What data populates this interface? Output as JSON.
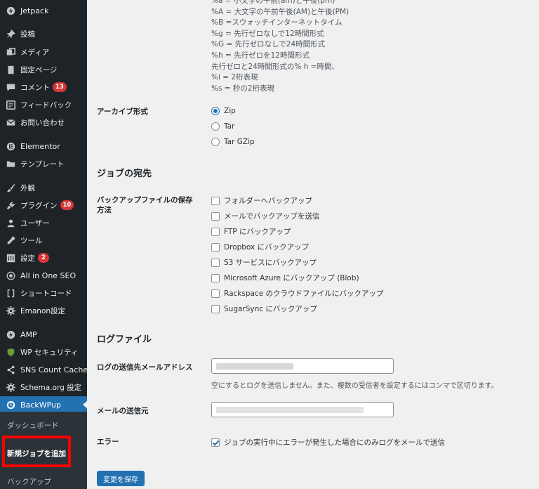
{
  "sidebar": {
    "items": [
      {
        "label": "Jetpack",
        "icon": "jetpack-icon"
      },
      {
        "label": "投稿",
        "icon": "pin-icon"
      },
      {
        "label": "メディア",
        "icon": "media-icon"
      },
      {
        "label": "固定ページ",
        "icon": "page-icon"
      },
      {
        "label": "コメント",
        "icon": "comment-icon",
        "badge": "13"
      },
      {
        "label": "フィードバック",
        "icon": "feedback-icon"
      },
      {
        "label": "お問い合わせ",
        "icon": "mail-icon"
      },
      {
        "label": "Elementor",
        "icon": "elementor-icon"
      },
      {
        "label": "テンプレート",
        "icon": "folder-icon"
      },
      {
        "label": "外観",
        "icon": "brush-icon"
      },
      {
        "label": "プラグイン",
        "icon": "plugin-icon",
        "badge": "10"
      },
      {
        "label": "ユーザー",
        "icon": "user-icon"
      },
      {
        "label": "ツール",
        "icon": "wrench-icon"
      },
      {
        "label": "設定",
        "icon": "settings-icon",
        "badge": "2"
      },
      {
        "label": "All in One SEO",
        "icon": "seo-icon"
      },
      {
        "label": "ショートコード",
        "icon": "shortcode-icon"
      },
      {
        "label": "Emanon設定",
        "icon": "gear-icon"
      },
      {
        "label": "AMP",
        "icon": "amp-icon"
      },
      {
        "label": "WP セキュリティ",
        "icon": "shield-icon"
      },
      {
        "label": "SNS Count Cache",
        "icon": "share-icon"
      },
      {
        "label": "Schema.org 設定",
        "icon": "gear-icon"
      },
      {
        "label": "BackWPup",
        "icon": "backwpup-icon"
      }
    ],
    "submenu": {
      "dashboard": "ダッシュボード",
      "add_job": "新規ジョブを追加",
      "backup": "バックアップ"
    }
  },
  "main": {
    "format_lines": [
      "%a = 小文字の午前(am)と午後(pm)",
      "%A = 大文字の午前午後(AM)と午後(PM)",
      "%B =スウォッチインターネットタイム",
      "%g = 先行ゼロなしで12時間形式",
      "%G = 先行ゼロなしで24時間形式",
      "%h = 先行ゼロを12時間形式",
      "先行ゼロと24時間形式の% h =時間、",
      "%i = 2桁表現",
      "%s = 秒の2桁表現"
    ],
    "archive_format": {
      "label": "アーカイブ形式",
      "options": [
        "Zip",
        "Tar",
        "Tar GZip"
      ],
      "selected": "Zip"
    },
    "job_destination": {
      "title": "ジョブの宛先",
      "label": "バックアップファイルの保存方法",
      "options": [
        "フォルダーへバックアップ",
        "メールでバックアップを送信",
        "FTP にバックアップ",
        "Dropbox にバックアップ",
        "S3 サービスにバックアップ",
        "Microsoft Azure にバックアップ (Blob)",
        "Rackspace のクラウドファイルにバックアップ",
        "SugarSync にバックアップ"
      ]
    },
    "log_file": {
      "title": "ログファイル",
      "email_label": "ログの送信先メールアドレス",
      "email_hint": "空にするとログを送信しません。また、複数の受信者を設定するにはコンマで区切ります。",
      "sender_label": "メールの送信元",
      "error_label": "エラー",
      "error_option": "ジョブの実行中にエラーが発生した場合にのみログをメールで送信",
      "error_checked": true
    },
    "save_label": "変更を保存"
  }
}
